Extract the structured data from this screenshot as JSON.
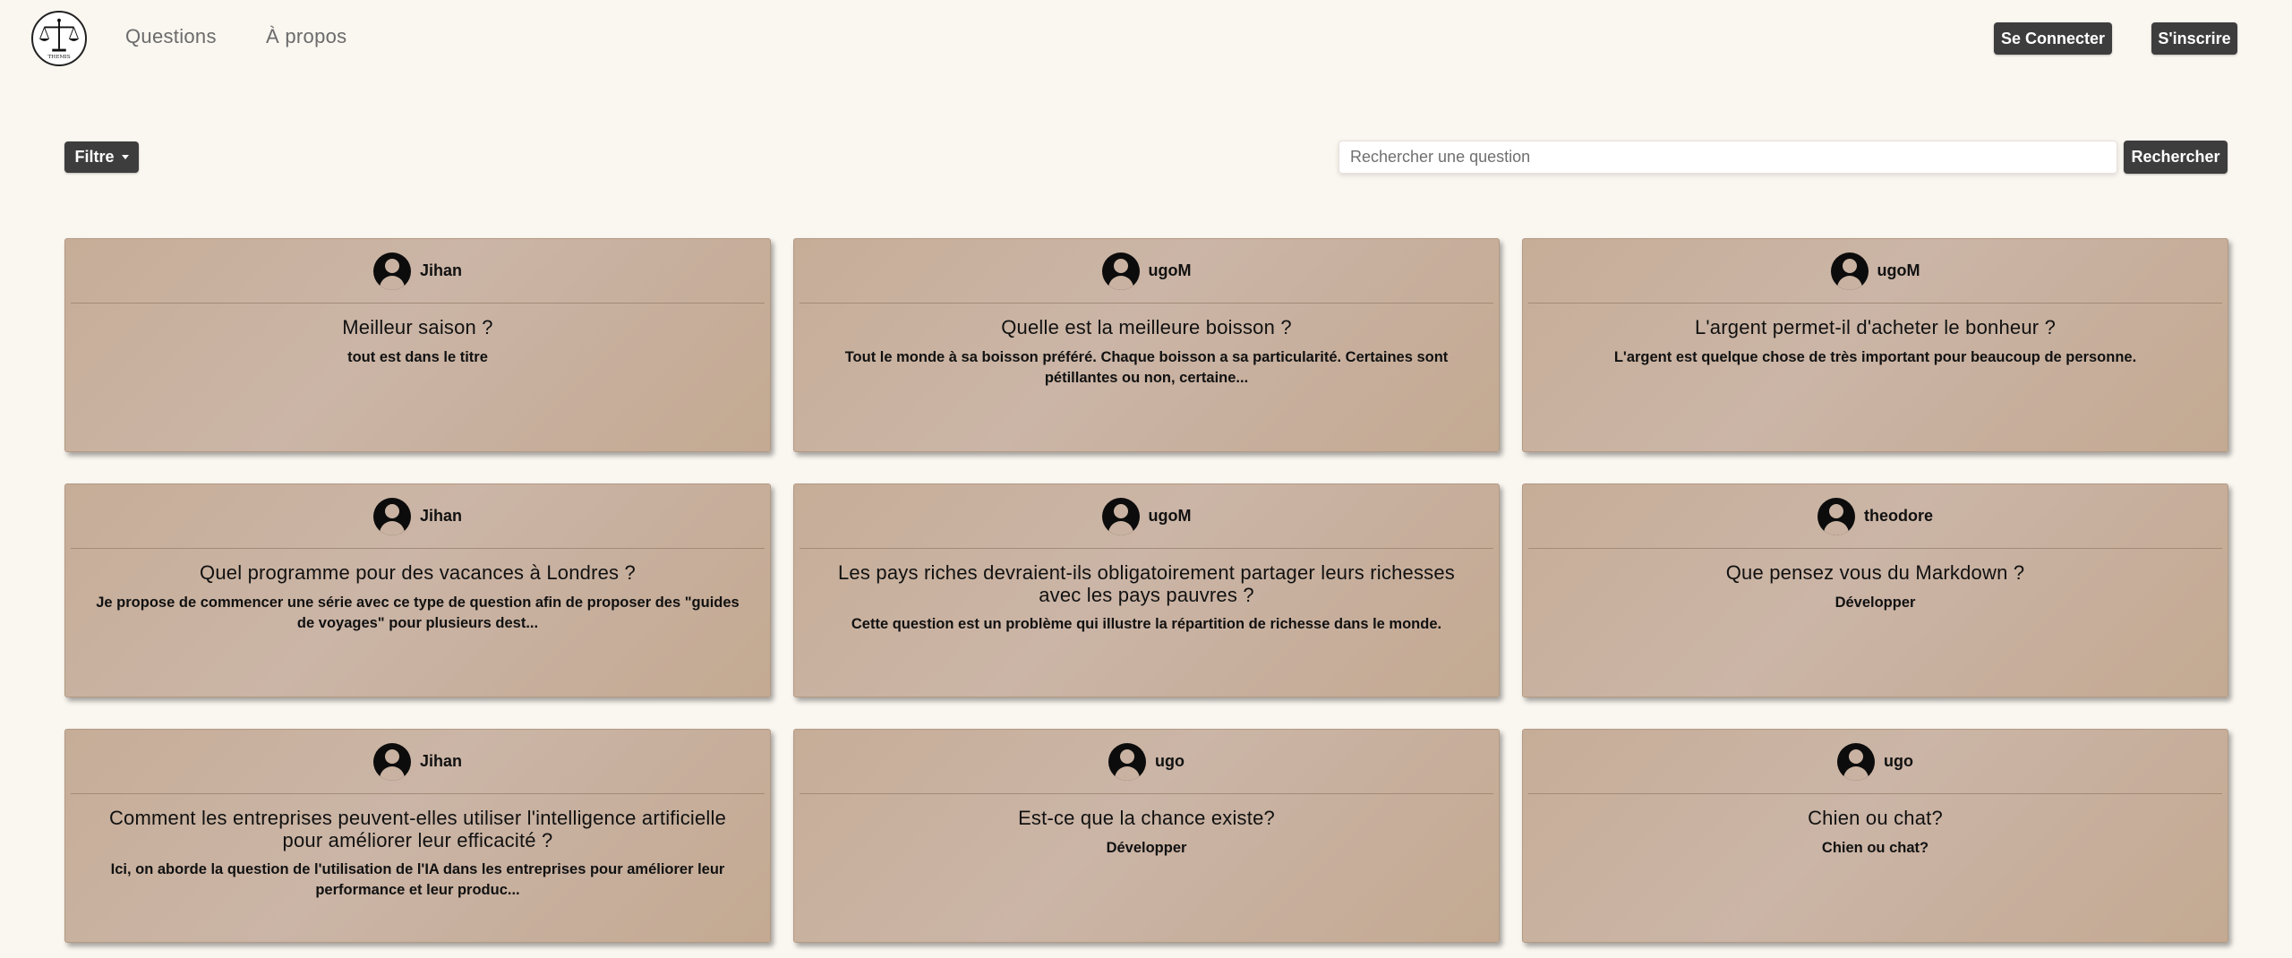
{
  "nav": {
    "logo_text": "THEMIS",
    "links": [
      "Questions",
      "À propos"
    ],
    "login_label": "Se Connecter",
    "signup_label": "S'inscrire"
  },
  "toolbar": {
    "filter_label": "Filtre",
    "search_placeholder": "Rechercher une question",
    "search_button_label": "Rechercher"
  },
  "cards": [
    {
      "author": "Jihan",
      "title": "Meilleur saison ?",
      "body": "tout est dans le titre"
    },
    {
      "author": "ugoM",
      "title": "Quelle est la meilleure boisson ?",
      "body": "Tout le monde à sa boisson préféré. Chaque boisson a sa particularité. Certaines sont pétillantes ou non, certaine..."
    },
    {
      "author": "ugoM",
      "title": "L'argent permet-il d'acheter le bonheur ?",
      "body": "L'argent est quelque chose de très important pour beaucoup de personne."
    },
    {
      "author": "Jihan",
      "title": "Quel programme pour des vacances à Londres ?",
      "body": "Je propose de commencer une série avec ce type de question afin de proposer des \"guides de voyages\" pour plusieurs dest..."
    },
    {
      "author": "ugoM",
      "title": "Les pays riches devraient-ils obligatoirement partager leurs richesses avec les pays pauvres ?",
      "body": "Cette question est un problème qui illustre la répartition de richesse dans le monde."
    },
    {
      "author": "theodore",
      "title": "Que pensez vous du Markdown ?",
      "body": "Développer"
    },
    {
      "author": "Jihan",
      "title": "Comment les entreprises peuvent-elles utiliser l'intelligence artificielle pour améliorer leur efficacité ?",
      "body": "Ici, on aborde la question de l'utilisation de l'IA dans les entreprises pour améliorer leur performance et leur produc..."
    },
    {
      "author": "ugo",
      "title": "Est-ce que la chance existe?",
      "body": "Développer"
    },
    {
      "author": "ugo",
      "title": "Chien ou chat?",
      "body": "Chien ou chat?"
    }
  ]
}
